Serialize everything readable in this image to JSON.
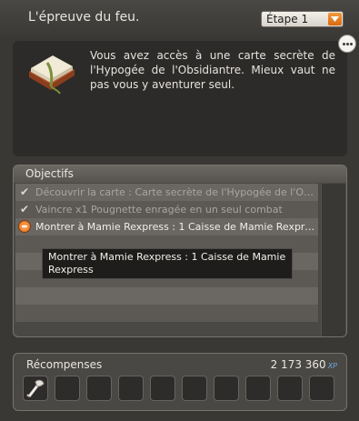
{
  "header": {
    "title": "L'épreuve du feu.",
    "step_select": "Étape 1"
  },
  "intro": {
    "text": "Vous avez accès à une carte secrète de l'Hypogée de l'Obsidiantre. Mieux vaut ne pas vous y aventurer seul."
  },
  "objectives": {
    "title": "Objectifs",
    "items": [
      {
        "text": "Découvrir la carte : Carte secrète de l'Hypogée de l'Obsidiantre",
        "status": "done"
      },
      {
        "text": "Vaincre x1 Pougnette enragée en un seul combat",
        "status": "done"
      },
      {
        "text": "Montrer à Mamie Rexpress : 1 Caisse de Mamie Rexpress",
        "status": "active"
      },
      {
        "text": "",
        "status": "empty"
      },
      {
        "text": "",
        "status": "empty"
      },
      {
        "text": "",
        "status": "empty"
      },
      {
        "text": "",
        "status": "empty"
      },
      {
        "text": "",
        "status": "empty"
      }
    ],
    "tooltip": "Montrer à Mamie Rexpress : 1 Caisse de Mamie Rexpress"
  },
  "rewards": {
    "title": "Récompenses",
    "xp_value": "2 173 360",
    "xp_unit": "XP",
    "slots": [
      "axe-item-icon",
      "",
      "",
      "",
      "",
      "",
      "",
      "",
      "",
      ""
    ]
  },
  "colors": {
    "accent": "#e27a1c",
    "panel": "#3a3835",
    "xp_blue": "#6ea7e0"
  }
}
